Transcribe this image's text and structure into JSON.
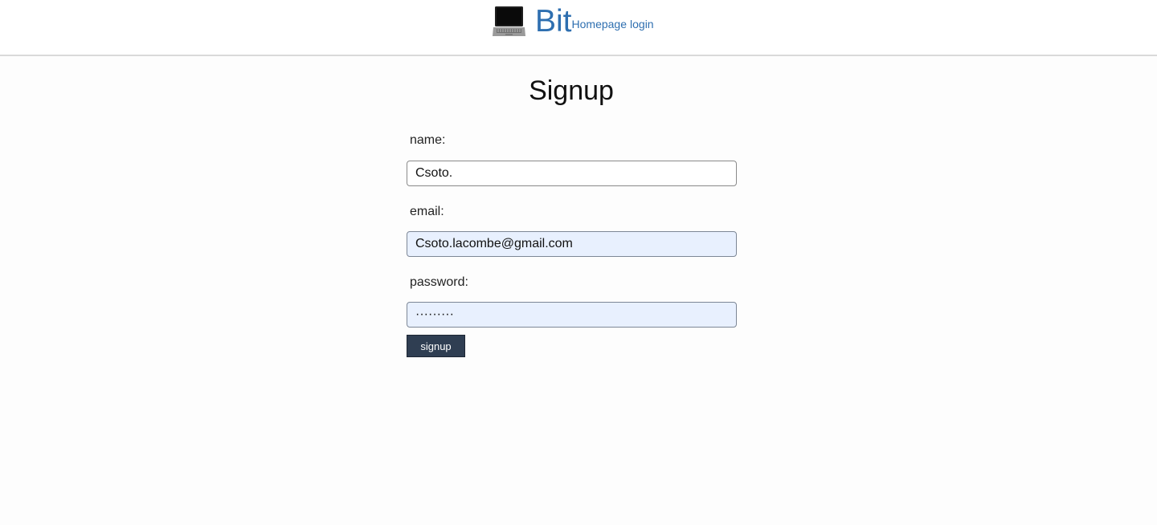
{
  "header": {
    "logo_icon": "laptop-icon",
    "brand": "Bit",
    "brand_color": "#2e6fb0",
    "links": [
      {
        "label": "Homepage"
      },
      {
        "label": "login"
      }
    ]
  },
  "form": {
    "title": "Signup",
    "fields": [
      {
        "label": "name:",
        "value": "Csoto.",
        "type": "text"
      },
      {
        "label": "email:",
        "value": "Csoto.lacombe@gmail.com",
        "type": "email"
      },
      {
        "label": "password:",
        "value": "·········",
        "type": "password"
      }
    ],
    "submit_label": "signup",
    "button_color": "#2f3e52",
    "autofill_color": "#e8f0fe"
  }
}
